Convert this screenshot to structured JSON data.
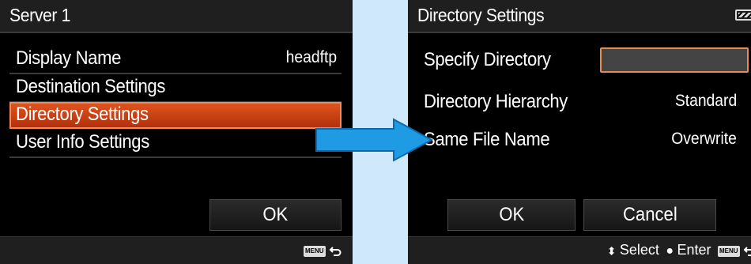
{
  "left_screen": {
    "title": "Server 1",
    "items": [
      {
        "label": "Display Name",
        "value": "headftp"
      },
      {
        "label": "Destination Settings",
        "value": ""
      },
      {
        "label": "Directory Settings",
        "value": ""
      },
      {
        "label": "User Info Settings",
        "value": ""
      }
    ],
    "selected_index": 2,
    "ok_label": "OK",
    "menu_icon_label": "MENU",
    "back_icon": "return-arrow-icon"
  },
  "right_screen": {
    "title": "Directory Settings",
    "battery_icon": "battery-icon",
    "items": [
      {
        "label": "Specify Directory",
        "value": ""
      },
      {
        "label": "Directory Hierarchy",
        "value": "Standard"
      },
      {
        "label": "Same File Name",
        "value": "Overwrite"
      }
    ],
    "ok_label": "OK",
    "cancel_label": "Cancel",
    "footer": {
      "select_label": "Select",
      "enter_label": "Enter",
      "menu_icon_label": "MENU"
    }
  },
  "colors": {
    "background": "#cfe8fb",
    "highlight": "#c8431a",
    "input_border": "#e38b52",
    "arrow": "#1e9be3"
  }
}
